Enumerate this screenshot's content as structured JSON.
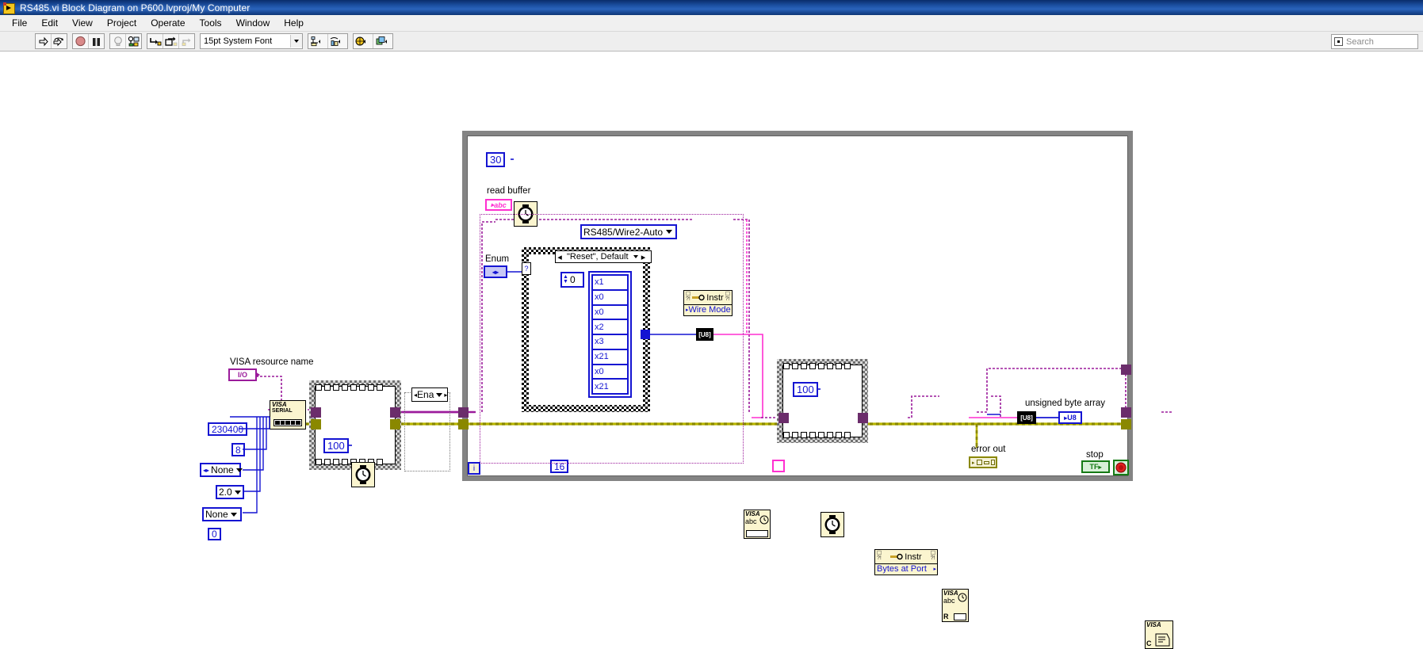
{
  "window": {
    "title": "RS485.vi Block Diagram on P600.lvproj/My Computer",
    "icon": "labview-vi-icon"
  },
  "menu": {
    "items": [
      "File",
      "Edit",
      "View",
      "Project",
      "Operate",
      "Tools",
      "Window",
      "Help"
    ]
  },
  "toolbar": {
    "buttons": [
      {
        "name": "run-button",
        "icon": "run-arrow-icon"
      },
      {
        "name": "run-continuously-button",
        "icon": "run-continuous-icon"
      },
      {
        "name": "abort-execution-button",
        "icon": "abort-stop-icon"
      },
      {
        "name": "pause-button",
        "icon": "pause-icon"
      },
      {
        "name": "highlight-execution-button",
        "icon": "lightbulb-icon"
      },
      {
        "name": "retain-wire-values-button",
        "icon": "retain-wire-values-icon"
      },
      {
        "name": "step-into-button",
        "icon": "step-into-icon"
      },
      {
        "name": "step-over-button",
        "icon": "step-over-icon"
      },
      {
        "name": "step-out-button",
        "icon": "step-out-icon"
      }
    ],
    "font_selector": {
      "value": "15pt System Font",
      "placeholder": "15pt System Font"
    },
    "align_objects": {
      "name": "align-objects-button",
      "icon": "align-objects-icon"
    },
    "distribute_objects": {
      "name": "distribute-objects-button",
      "icon": "distribute-objects-icon"
    },
    "resize_objects": {
      "name": "resize-objects-button",
      "icon": "resize-objects-icon"
    },
    "reorder_objects": {
      "name": "reorder-objects-button",
      "icon": "reorder-objects-icon"
    },
    "search": {
      "placeholder": "Search",
      "value": "Search"
    }
  },
  "diagram": {
    "labels": {
      "visa_resource_name": "VISA resource name",
      "read_buffer": "read buffer",
      "enum": "Enum",
      "unsigned_byte_array": "unsigned byte array",
      "error_out": "error out",
      "stop": "stop"
    },
    "constants": {
      "baud_rate": "230400",
      "data_bits": "8",
      "parity": "None",
      "stop_bits": "2.0",
      "flow_control": "None",
      "extra_zero": "0",
      "wait_outer": "100",
      "wait_timeout_top": "30",
      "wait_inner_right": "100",
      "array_index": "0",
      "bytes_count": "16"
    },
    "array_elements": [
      "x1",
      "x0",
      "x0",
      "x2",
      "x3",
      "x21",
      "x0",
      "x21"
    ],
    "rings": {
      "wire_mode": "RS485/Wire2-Auto",
      "enable_ring": "Ena"
    },
    "case_selector": "\"Reset\", Default",
    "property_nodes": [
      {
        "class": "Instr",
        "property": "Wire Mode"
      },
      {
        "class": "Instr",
        "property": "Bytes at Port"
      }
    ],
    "nodes": {
      "visa_configure_serial_port": "VISA SERIAL",
      "visa_write": "VISA abc",
      "visa_read": "VISA abc R",
      "visa_close": "VISA C",
      "string_to_byte_array": "[U8]",
      "byte_array_converter": "[U8]"
    },
    "terminals": {
      "visa_io": "I/O",
      "read_buffer": "abc",
      "unsigned_byte_array": "U8",
      "stop_boolean": "TF",
      "iteration": "i"
    },
    "colors": {
      "wire_visa": "#9b1b9b",
      "wire_error": "#b7b400",
      "wire_string": "#ff2fd0",
      "wire_numeric": "#1414d2",
      "structure_grey": "#848484",
      "constant_blue": "#1414d2",
      "subvi_yellow": "#fbf5cf",
      "title_blue": "#1b4fa0"
    }
  }
}
